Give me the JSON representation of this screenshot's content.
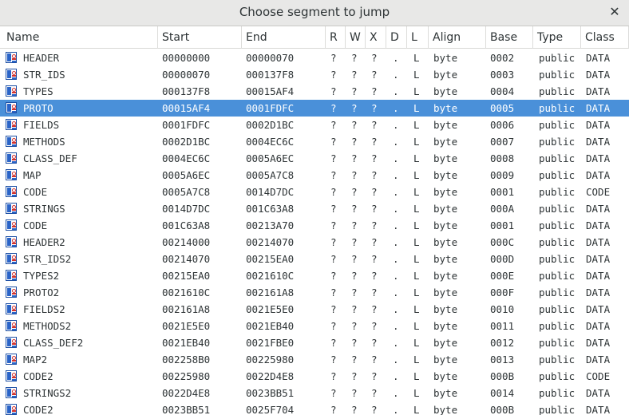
{
  "window": {
    "title": "Choose segment to jump",
    "close_glyph": "✕"
  },
  "table": {
    "columns": [
      "Name",
      "Start",
      "End",
      "R",
      "W",
      "X",
      "D",
      "L",
      "Align",
      "Base",
      "Type",
      "Class"
    ],
    "selected_row": 3,
    "selection_color": "#4a90d9",
    "row_icon": "segment-icon",
    "rows": [
      {
        "name": "HEADER",
        "start": "00000000",
        "end": "00000070",
        "r": "?",
        "w": "?",
        "x": "?",
        "d": ".",
        "l": "L",
        "align": "byte",
        "base": "0002",
        "type": "public",
        "class": "DATA"
      },
      {
        "name": "STR_IDS",
        "start": "00000070",
        "end": "000137F8",
        "r": "?",
        "w": "?",
        "x": "?",
        "d": ".",
        "l": "L",
        "align": "byte",
        "base": "0003",
        "type": "public",
        "class": "DATA"
      },
      {
        "name": "TYPES",
        "start": "000137F8",
        "end": "00015AF4",
        "r": "?",
        "w": "?",
        "x": "?",
        "d": ".",
        "l": "L",
        "align": "byte",
        "base": "0004",
        "type": "public",
        "class": "DATA"
      },
      {
        "name": "PROTO",
        "start": "00015AF4",
        "end": "0001FDFC",
        "r": "?",
        "w": "?",
        "x": "?",
        "d": ".",
        "l": "L",
        "align": "byte",
        "base": "0005",
        "type": "public",
        "class": "DATA"
      },
      {
        "name": "FIELDS",
        "start": "0001FDFC",
        "end": "0002D1BC",
        "r": "?",
        "w": "?",
        "x": "?",
        "d": ".",
        "l": "L",
        "align": "byte",
        "base": "0006",
        "type": "public",
        "class": "DATA"
      },
      {
        "name": "METHODS",
        "start": "0002D1BC",
        "end": "0004EC6C",
        "r": "?",
        "w": "?",
        "x": "?",
        "d": ".",
        "l": "L",
        "align": "byte",
        "base": "0007",
        "type": "public",
        "class": "DATA"
      },
      {
        "name": "CLASS_DEF",
        "start": "0004EC6C",
        "end": "0005A6EC",
        "r": "?",
        "w": "?",
        "x": "?",
        "d": ".",
        "l": "L",
        "align": "byte",
        "base": "0008",
        "type": "public",
        "class": "DATA"
      },
      {
        "name": "MAP",
        "start": "0005A6EC",
        "end": "0005A7C8",
        "r": "?",
        "w": "?",
        "x": "?",
        "d": ".",
        "l": "L",
        "align": "byte",
        "base": "0009",
        "type": "public",
        "class": "DATA"
      },
      {
        "name": "CODE",
        "start": "0005A7C8",
        "end": "0014D7DC",
        "r": "?",
        "w": "?",
        "x": "?",
        "d": ".",
        "l": "L",
        "align": "byte",
        "base": "0001",
        "type": "public",
        "class": "CODE"
      },
      {
        "name": "STRINGS",
        "start": "0014D7DC",
        "end": "001C63A8",
        "r": "?",
        "w": "?",
        "x": "?",
        "d": ".",
        "l": "L",
        "align": "byte",
        "base": "000A",
        "type": "public",
        "class": "DATA"
      },
      {
        "name": "CODE",
        "start": "001C63A8",
        "end": "00213A70",
        "r": "?",
        "w": "?",
        "x": "?",
        "d": ".",
        "l": "L",
        "align": "byte",
        "base": "0001",
        "type": "public",
        "class": "DATA"
      },
      {
        "name": "HEADER2",
        "start": "00214000",
        "end": "00214070",
        "r": "?",
        "w": "?",
        "x": "?",
        "d": ".",
        "l": "L",
        "align": "byte",
        "base": "000C",
        "type": "public",
        "class": "DATA"
      },
      {
        "name": "STR_IDS2",
        "start": "00214070",
        "end": "00215EA0",
        "r": "?",
        "w": "?",
        "x": "?",
        "d": ".",
        "l": "L",
        "align": "byte",
        "base": "000D",
        "type": "public",
        "class": "DATA"
      },
      {
        "name": "TYPES2",
        "start": "00215EA0",
        "end": "0021610C",
        "r": "?",
        "w": "?",
        "x": "?",
        "d": ".",
        "l": "L",
        "align": "byte",
        "base": "000E",
        "type": "public",
        "class": "DATA"
      },
      {
        "name": "PROTO2",
        "start": "0021610C",
        "end": "002161A8",
        "r": "?",
        "w": "?",
        "x": "?",
        "d": ".",
        "l": "L",
        "align": "byte",
        "base": "000F",
        "type": "public",
        "class": "DATA"
      },
      {
        "name": "FIELDS2",
        "start": "002161A8",
        "end": "0021E5E0",
        "r": "?",
        "w": "?",
        "x": "?",
        "d": ".",
        "l": "L",
        "align": "byte",
        "base": "0010",
        "type": "public",
        "class": "DATA"
      },
      {
        "name": "METHODS2",
        "start": "0021E5E0",
        "end": "0021EB40",
        "r": "?",
        "w": "?",
        "x": "?",
        "d": ".",
        "l": "L",
        "align": "byte",
        "base": "0011",
        "type": "public",
        "class": "DATA"
      },
      {
        "name": "CLASS_DEF2",
        "start": "0021EB40",
        "end": "0021FBE0",
        "r": "?",
        "w": "?",
        "x": "?",
        "d": ".",
        "l": "L",
        "align": "byte",
        "base": "0012",
        "type": "public",
        "class": "DATA"
      },
      {
        "name": "MAP2",
        "start": "002258B0",
        "end": "00225980",
        "r": "?",
        "w": "?",
        "x": "?",
        "d": ".",
        "l": "L",
        "align": "byte",
        "base": "0013",
        "type": "public",
        "class": "DATA"
      },
      {
        "name": "CODE2",
        "start": "00225980",
        "end": "0022D4E8",
        "r": "?",
        "w": "?",
        "x": "?",
        "d": ".",
        "l": "L",
        "align": "byte",
        "base": "000B",
        "type": "public",
        "class": "CODE"
      },
      {
        "name": "STRINGS2",
        "start": "0022D4E8",
        "end": "0023BB51",
        "r": "?",
        "w": "?",
        "x": "?",
        "d": ".",
        "l": "L",
        "align": "byte",
        "base": "0014",
        "type": "public",
        "class": "DATA"
      },
      {
        "name": "CODE2",
        "start": "0023BB51",
        "end": "0025F704",
        "r": "?",
        "w": "?",
        "x": "?",
        "d": ".",
        "l": "L",
        "align": "byte",
        "base": "000B",
        "type": "public",
        "class": "DATA"
      }
    ]
  }
}
